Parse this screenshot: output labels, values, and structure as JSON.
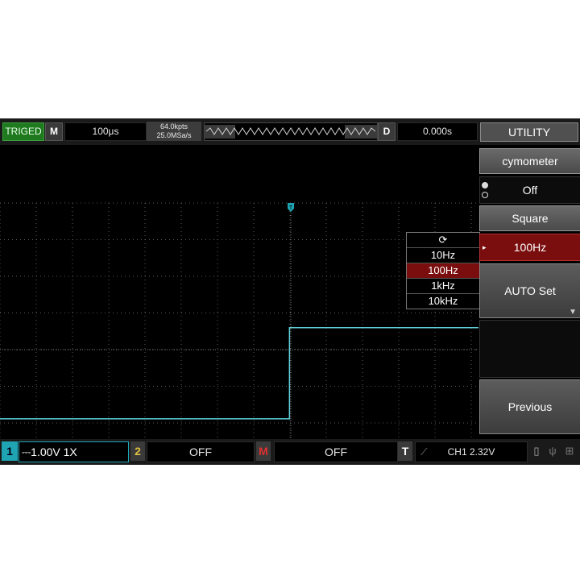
{
  "topbar": {
    "trig_status": "TRIGED",
    "m_label": "M",
    "timebase": "100μs",
    "memory_depth": "64.0kpts",
    "sample_rate": "25.0MSa/s",
    "d_label": "D",
    "delay": "0.000s",
    "menu_title": "UTILITY"
  },
  "menu": {
    "item1_label": "cymometer",
    "item1_value": "Off",
    "item2_label": "Square",
    "item2_value": "100Hz",
    "item3_label": "AUTO Set",
    "item4_label": "Previous"
  },
  "popup": {
    "options": [
      "10Hz",
      "100Hz",
      "1kHz",
      "10kHz"
    ],
    "selected": "100Hz"
  },
  "bottombar": {
    "ch1_num": "1",
    "ch1_info": "⎓1.00V 1X",
    "ch2_num": "2",
    "ch2_state": "OFF",
    "math_num": "M",
    "math_state": "OFF",
    "trig_num": "T",
    "trig_info": "CH1 2.32V"
  },
  "markers": {
    "trigger_marker": "T",
    "ch1_marker": "1"
  },
  "waveform": {
    "type": "square",
    "low_level": 0.264,
    "high_level": 0.575,
    "edge_at": 0.605,
    "color": "#5fd0d8"
  },
  "colors": {
    "ch1": "#1fa4b4",
    "ch2": "#e0c040",
    "math": "#e03030",
    "selected": "#7a0e0e",
    "triged": "#1f7a1f"
  }
}
